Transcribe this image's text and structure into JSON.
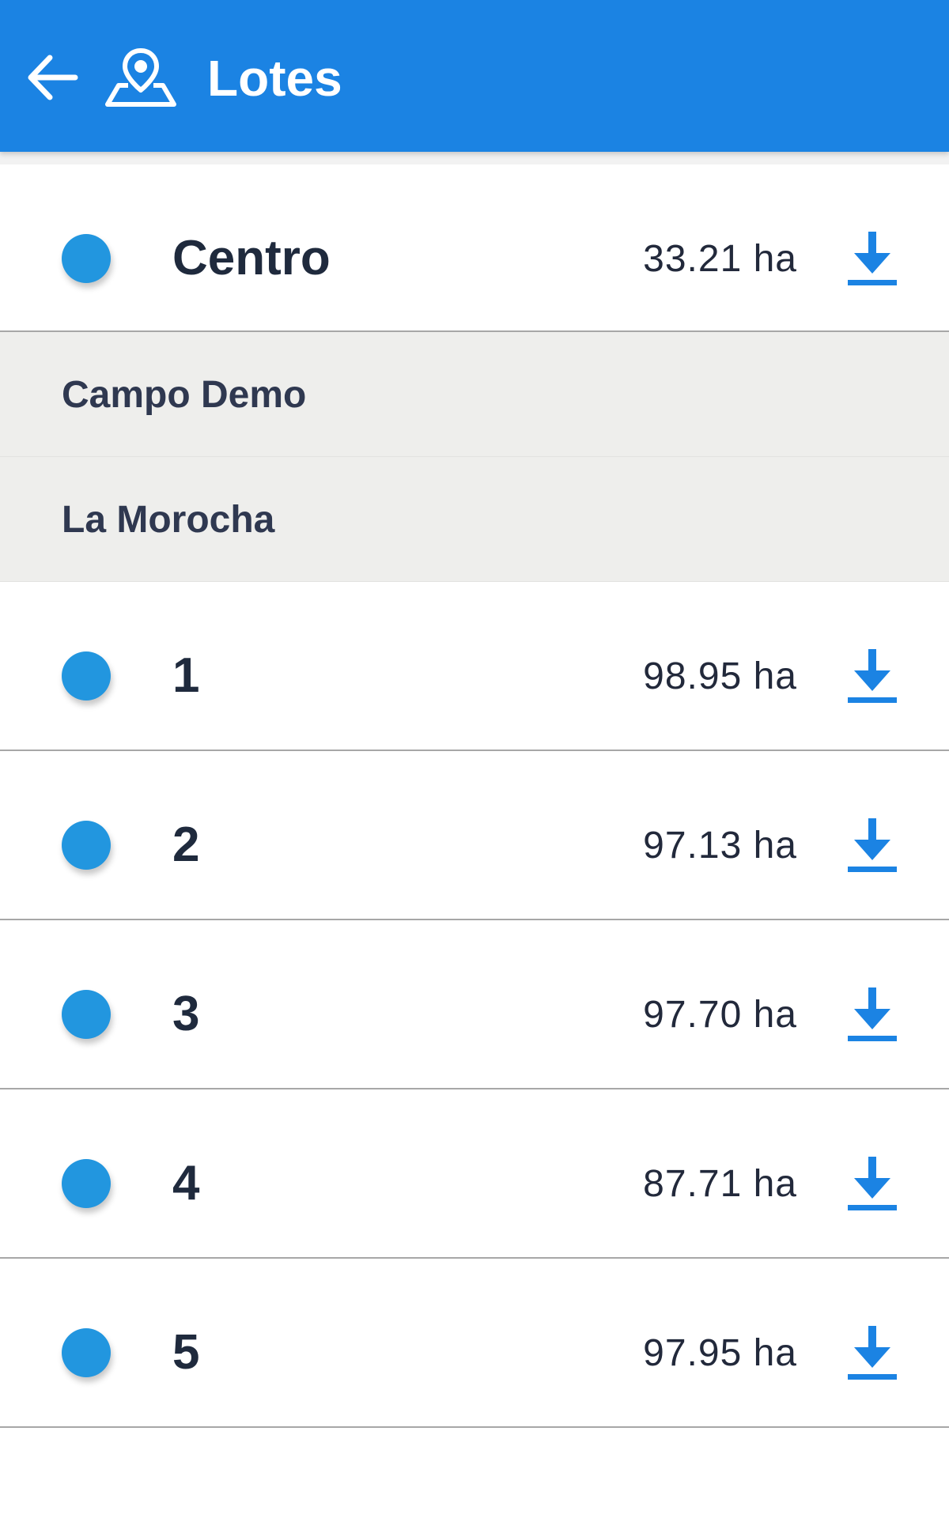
{
  "appbar": {
    "title": "Lotes",
    "back_icon": "arrow-left-icon",
    "app_icon": "map-pin-icon",
    "background": "#1b83e3"
  },
  "list": {
    "first_item": {
      "name": "Centro",
      "area": "33.21 ha",
      "dot_color": "#2296df",
      "action_icon": "download-icon"
    },
    "groups": [
      {
        "label": "Campo Demo"
      },
      {
        "label": "La Morocha"
      }
    ],
    "items": [
      {
        "name": "1",
        "area": "98.95 ha"
      },
      {
        "name": "2",
        "area": "97.13 ha"
      },
      {
        "name": "3",
        "area": "97.70 ha"
      },
      {
        "name": "4",
        "area": "87.71 ha"
      },
      {
        "name": "5",
        "area": "97.95 ha"
      }
    ]
  },
  "colors": {
    "accent": "#1b83e3",
    "dot": "#2296df",
    "group_bg": "#eeeeec",
    "text_dark": "#1f2a3d"
  }
}
